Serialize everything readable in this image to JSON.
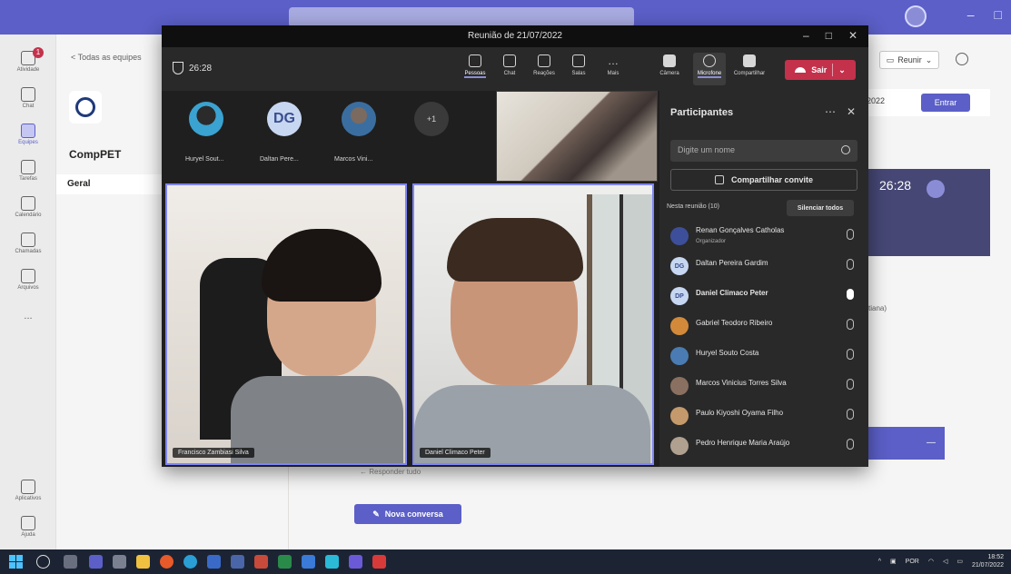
{
  "meeting": {
    "title": "Reunião de 21/07/2022",
    "timer": "26:28",
    "toolbar": {
      "people": "Pessoas",
      "chat": "Chat",
      "reactions": "Reações",
      "rooms": "Salas",
      "more": "Mais",
      "camera": "Câmera",
      "microphone": "Microfone",
      "share": "Compartilhar",
      "leave": "Sair"
    },
    "strip": [
      {
        "name": "Huryel Sout...",
        "initials": ""
      },
      {
        "name": "Daltan Pere...",
        "initials": "DG"
      },
      {
        "name": "Marcos Vini...",
        "initials": ""
      },
      {
        "name": "",
        "initials": "+1"
      }
    ],
    "tiles": [
      {
        "name": "Francisco Zambiasi Silva"
      },
      {
        "name": "Daniel Climaco Peter"
      }
    ]
  },
  "participants": {
    "title": "Participantes",
    "search_placeholder": "Digite um nome",
    "share_invite": "Compartilhar convite",
    "section": "Nesta reunião (10)",
    "mute_all": "Silenciar todos",
    "people": [
      {
        "name": "Renan Gonçalves Catholas",
        "role": "Organizador",
        "initials": "",
        "color": "#3d4f9a",
        "bold": false,
        "mic_on": false
      },
      {
        "name": "Daltan Pereira Gardim",
        "role": "",
        "initials": "DG",
        "color": "#c7d7f2",
        "bold": false,
        "mic_on": false
      },
      {
        "name": "Daniel Climaco Peter",
        "role": "",
        "initials": "DP",
        "color": "#c7d7f2",
        "bold": true,
        "mic_on": true
      },
      {
        "name": "Gabriel Teodoro Ribeiro",
        "role": "",
        "initials": "",
        "color": "#d28a3a",
        "bold": false,
        "mic_on": false
      },
      {
        "name": "Huryel Souto Costa",
        "role": "",
        "initials": "",
        "color": "#4a7cb3",
        "bold": false,
        "mic_on": false
      },
      {
        "name": "Marcos Vinicius Torres Silva",
        "role": "",
        "initials": "",
        "color": "#8a7060",
        "bold": false,
        "mic_on": false
      },
      {
        "name": "Paulo Kiyoshi Oyama Filho",
        "role": "",
        "initials": "",
        "color": "#c49a6c",
        "bold": false,
        "mic_on": false
      },
      {
        "name": "Pedro Henrique Maria Araújo",
        "role": "",
        "initials": "",
        "color": "#b0a090",
        "bold": false,
        "mic_on": false
      }
    ]
  },
  "teams": {
    "back": "< Todas as equipes",
    "team_name": "CompPET",
    "channel": "Geral",
    "join_label": "Entrar",
    "date_fragment": "2022",
    "card_timer": "26:28",
    "reunir_label": "Reunir",
    "reply": "← Responder tudo",
    "new_conversation": "Nova conversa",
    "side_text": "tiana)",
    "rail": [
      {
        "label": "Atividade"
      },
      {
        "label": "Chat"
      },
      {
        "label": "Equipes"
      },
      {
        "label": "Tarefas"
      },
      {
        "label": "Calendário"
      },
      {
        "label": "Chamadas"
      },
      {
        "label": "Arquivos"
      },
      {
        "label": "..."
      },
      {
        "label": "Aplicativos"
      },
      {
        "label": "Ajuda"
      }
    ],
    "activity_badge": "1"
  },
  "taskbar": {
    "lang": "POR",
    "time": "18:52",
    "date": "21/07/2022"
  },
  "colors": {
    "teams_purple": "#5b5fc7",
    "leave_red": "#c4314b",
    "tile_border": "#7f85f5"
  }
}
